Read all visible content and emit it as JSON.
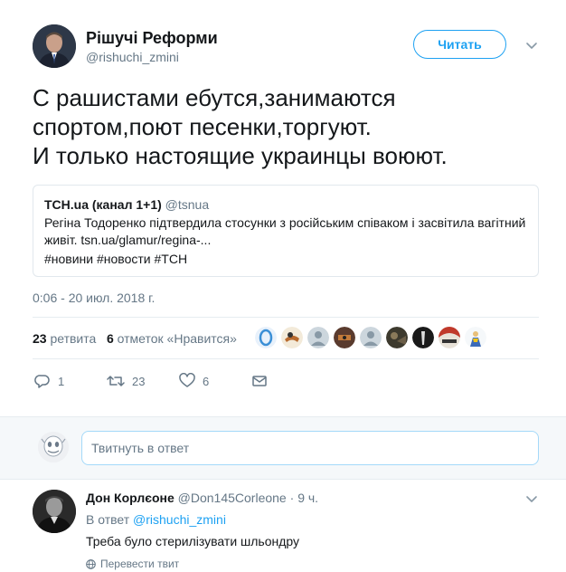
{
  "tweet": {
    "author": {
      "display_name": "Рішучі Реформи",
      "handle": "@rishuchi_zmini"
    },
    "follow_label": "Читать",
    "text_lines": [
      "С рашистами ебутся,занимаются",
      "спортом,поют песенки,торгуют.",
      "И только настоящие украинцы воюют."
    ],
    "quote": {
      "name": "ТСН.ua (канал 1+1)",
      "handle": "@tsnua",
      "text": "Регіна Тодоренко підтвердила стосунки з російським співаком і засвітила вагітний живіт. tsn.ua/glamur/regina-...",
      "hashtags": "#новини #новости #ТСН"
    },
    "timestamp": "0:06 - 20 июл. 2018 г.",
    "stats": {
      "retweets_count": "23",
      "retweets_label": "ретвита",
      "likes_count": "6",
      "likes_label": "отметок «Нравится»"
    },
    "actions": {
      "replies": "1",
      "retweets": "23",
      "likes": "6"
    }
  },
  "reply_box": {
    "placeholder": "Твитнуть в ответ"
  },
  "reply": {
    "display_name": "Дон Корлєоне",
    "handle": "@Don145Corleone",
    "separator": "·",
    "time": "9 ч.",
    "reply_to_label": "В ответ",
    "reply_to_handle": "@rishuchi_zmini",
    "text": "Треба було стерилізувати шльондру",
    "translate_label": "Перевести твит"
  },
  "colors": {
    "accent": "#1da1f2",
    "secondary_text": "#657786",
    "primary_text": "#14171a"
  }
}
